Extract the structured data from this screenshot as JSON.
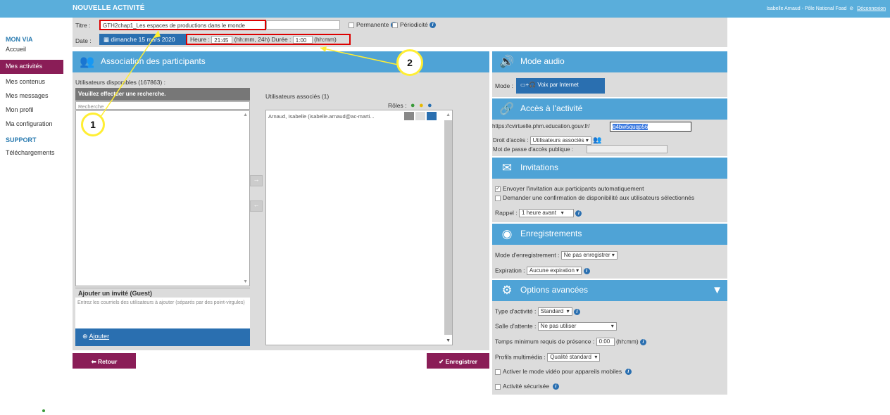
{
  "header": {
    "title": "NOUVELLE ACTIVITÉ",
    "user": "Isabelle Arnaud - Pôle National Foad",
    "logout": "Déconnexion"
  },
  "sidebar": {
    "section1": "MON VIA",
    "items": [
      "Accueil",
      "Mes activités",
      "Mes contenus",
      "Mes messages",
      "Mon profil",
      "Ma configuration"
    ],
    "section2": "SUPPORT",
    "items2": [
      "Téléchargements"
    ]
  },
  "form": {
    "title_label": "Titre :",
    "title_value": "GTH2chap1_Les espaces de productions dans le monde",
    "permanent": "Permanente",
    "periodic": "Périodicité",
    "date_label": "Date :",
    "date_value": "dimanche 15 mars 2020",
    "hour_label": "Heure :",
    "hour_value": "21:45",
    "hour_format": "(hh:mm, 24h)",
    "duration_label": "Durée :",
    "duration_value": "1:00",
    "duration_format": "(hh:mm)"
  },
  "participants": {
    "header": "Association des participants",
    "available": "Utilisateurs disponibles (167863) :",
    "search_prompt": "Veuillez effectuer une recherche.",
    "search_placeholder": "Recherche",
    "associated": "Utilisateurs associés (1)",
    "roles": "Rôles :",
    "associated_user": "Arnaud, Isabelle (isabelle.arnaud@ac-marti...",
    "guest_title": "Ajouter un invité (Guest)",
    "guest_placeholder": "Entrez les courriels des utilisateurs à ajouter (séparés par des point-virgules)",
    "add": "Ajouter"
  },
  "buttons": {
    "back": "Retour",
    "save": "Enregistrer"
  },
  "audio": {
    "header": "Mode audio",
    "mode_label": "Mode :",
    "mode_value": "Voix par Internet"
  },
  "access": {
    "header": "Accès à l'activité",
    "url_prefix": "https://cvirtuelle.phm.education.gouv.fr/",
    "url_code": "q4bw5quqp56",
    "rights_label": "Droit d'accès :",
    "rights_value": "Utilisateurs associés",
    "password_label": "Mot de passe d'accès publique :"
  },
  "invitations": {
    "header": "Invitations",
    "opt1": "Envoyer l'invitation aux participants automatiquement",
    "opt2": "Demander une confirmation de disponibilité aux utilisateurs sélectionnés",
    "reminder_label": "Rappel :",
    "reminder_value": "1 heure avant"
  },
  "recordings": {
    "header": "Enregistrements",
    "mode_label": "Mode d'enregistrement :",
    "mode_value": "Ne pas enregistrer",
    "expiration_label": "Expiration :",
    "expiration_value": "Aucune expiration"
  },
  "advanced": {
    "header": "Options avancées",
    "type_label": "Type d'activité :",
    "type_value": "Standard",
    "waiting_label": "Salle d'attente :",
    "waiting_value": "Ne pas utiliser",
    "min_label": "Temps minimum requis de présence :",
    "min_value": "0:00",
    "min_format": "(hh:mm)",
    "profiles_label": "Profils multimédia :",
    "profiles_value": "Qualité standard",
    "video": "Activer le mode vidéo pour appareils mobiles",
    "secure": "Activité sécurisée"
  },
  "annotations": {
    "one": "1",
    "two": "2"
  },
  "colors": {
    "blue": "#4fa3d6",
    "dark_blue": "#2a6fb0",
    "maroon": "#8a1d57",
    "red": "#dd0000",
    "yellow": "#ffee33"
  }
}
